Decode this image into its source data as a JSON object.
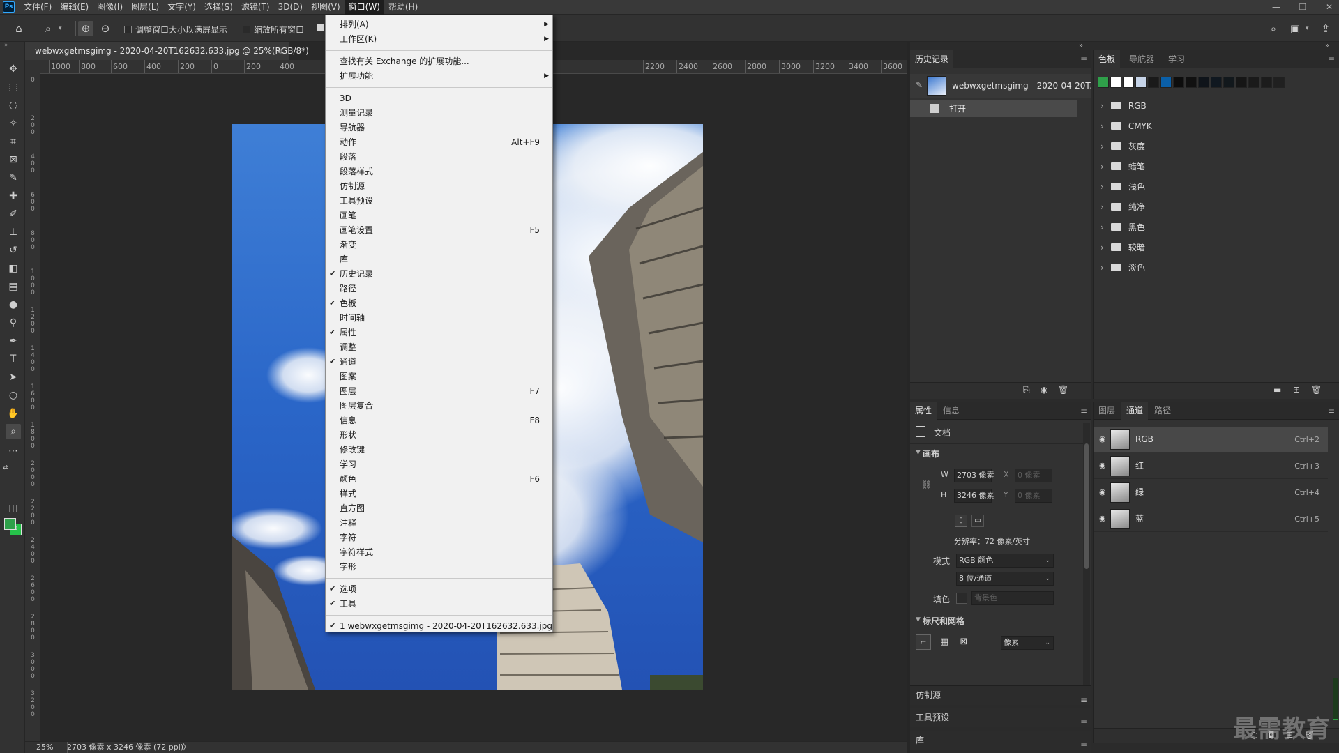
{
  "app": {
    "logo": "Ps"
  },
  "menubar": {
    "items": [
      "文件(F)",
      "编辑(E)",
      "图像(I)",
      "图层(L)",
      "文字(Y)",
      "选择(S)",
      "滤镜(T)",
      "3D(D)",
      "视图(V)",
      "窗口(W)",
      "帮助(H)"
    ],
    "active_index": 9,
    "window_controls": [
      "—",
      "❐",
      "✕"
    ]
  },
  "options": {
    "zoom_tool_icon": "zoom-icon",
    "check1": "调整窗口大小以满屏显示",
    "check2": "缩放所有窗口"
  },
  "document": {
    "tab_title": "webwxgetmsgimg - 2020-04-20T162632.633.jpg @ 25%(RGB/8*)",
    "close": "×",
    "ruler_h_labels": [
      "1000",
      "800",
      "600",
      "400",
      "200",
      "0",
      "200",
      "400",
      "2200",
      "2400",
      "2600",
      "2800",
      "3000",
      "3200",
      "3400",
      "3600"
    ],
    "ruler_v_labels": [
      "0",
      "200",
      "400",
      "600",
      "800",
      "1000",
      "1200",
      "1400",
      "1600",
      "1800",
      "2000",
      "2200",
      "2400",
      "2600",
      "2800",
      "3000",
      "3200"
    ],
    "status_zoom": "25%",
    "status_info": "2703 像素 x 3246 像素 (72 ppi)",
    "status_arrow": "〉"
  },
  "window_menu": {
    "items": [
      {
        "label": "排列(A)",
        "submenu": true
      },
      {
        "label": "工作区(K)",
        "submenu": true
      },
      {
        "sep": true
      },
      {
        "label": "查找有关 Exchange 的扩展功能..."
      },
      {
        "label": "扩展功能",
        "submenu": true
      },
      {
        "sep": true
      },
      {
        "label": "3D"
      },
      {
        "label": "测量记录"
      },
      {
        "label": "导航器"
      },
      {
        "label": "动作",
        "shortcut": "Alt+F9"
      },
      {
        "label": "段落"
      },
      {
        "label": "段落样式"
      },
      {
        "label": "仿制源"
      },
      {
        "label": "工具预设"
      },
      {
        "label": "画笔"
      },
      {
        "label": "画笔设置",
        "shortcut": "F5"
      },
      {
        "label": "渐变"
      },
      {
        "label": "库"
      },
      {
        "label": "历史记录",
        "checked": true
      },
      {
        "label": "路径"
      },
      {
        "label": "色板",
        "checked": true
      },
      {
        "label": "时间轴"
      },
      {
        "label": "属性",
        "checked": true
      },
      {
        "label": "调整"
      },
      {
        "label": "通道",
        "checked": true
      },
      {
        "label": "图案"
      },
      {
        "label": "图层",
        "shortcut": "F7"
      },
      {
        "label": "图层复合"
      },
      {
        "label": "信息",
        "shortcut": "F8"
      },
      {
        "label": "形状"
      },
      {
        "label": "修改键"
      },
      {
        "label": "学习"
      },
      {
        "label": "颜色",
        "shortcut": "F6"
      },
      {
        "label": "样式"
      },
      {
        "label": "直方图"
      },
      {
        "label": "注释"
      },
      {
        "label": "字符"
      },
      {
        "label": "字符样式"
      },
      {
        "label": "字形"
      },
      {
        "sep": true
      },
      {
        "label": "选项",
        "checked": true
      },
      {
        "label": "工具",
        "checked": true
      },
      {
        "sep": true
      },
      {
        "label": "1 webwxgetmsgimg - 2020-04-20T162632.633.jpg",
        "checked": true
      }
    ]
  },
  "history": {
    "tab": "历史记录",
    "snapshot": "webwxgetmsgimg - 2020-04-20T...",
    "steps": [
      "打开"
    ]
  },
  "swatches": {
    "tabs": [
      "色板",
      "导航器",
      "学习"
    ],
    "colors": [
      "#2fa04a",
      "#ffffff",
      "#ffffff",
      "#c6d4e8",
      "#1a1a1a",
      "#0a5fa8",
      "#0d0d0d",
      "#111111",
      "#0f141a",
      "#101820",
      "#12181c",
      "#161616",
      "#1a1a1a",
      "#1c1c1c",
      "#202020"
    ],
    "groups": [
      "RGB",
      "CMYK",
      "灰度",
      "蜡笔",
      "浅色",
      "纯净",
      "黑色",
      "较暗",
      "淡色"
    ]
  },
  "properties": {
    "tabs": [
      "属性",
      "信息"
    ],
    "doc_label": "文档",
    "canvas_section": "画布",
    "w_label": "W",
    "w_value": "2703 像素",
    "h_label": "H",
    "h_value": "3246 像素",
    "x_label": "X",
    "x_value": "0 像素",
    "y_label": "Y",
    "y_value": "0 像素",
    "resolution": "分辨率：72 像素/英寸",
    "mode_label": "模式",
    "mode_value": "RGB 颜色",
    "depth_value": "8 位/通道",
    "fill_label": "填色",
    "fill_value": "背景色",
    "rulers_section": "标尺和网格",
    "unit_value": "像素"
  },
  "channels": {
    "tabs": [
      "图层",
      "通道",
      "路径"
    ],
    "rows": [
      {
        "name": "RGB",
        "shortcut": "Ctrl+2"
      },
      {
        "name": "红",
        "shortcut": "Ctrl+3"
      },
      {
        "name": "绿",
        "shortcut": "Ctrl+4"
      },
      {
        "name": "蓝",
        "shortcut": "Ctrl+5"
      }
    ]
  },
  "collapsed_panels": [
    "仿制源",
    "工具预设",
    "库"
  ],
  "watermark": "最需教育"
}
